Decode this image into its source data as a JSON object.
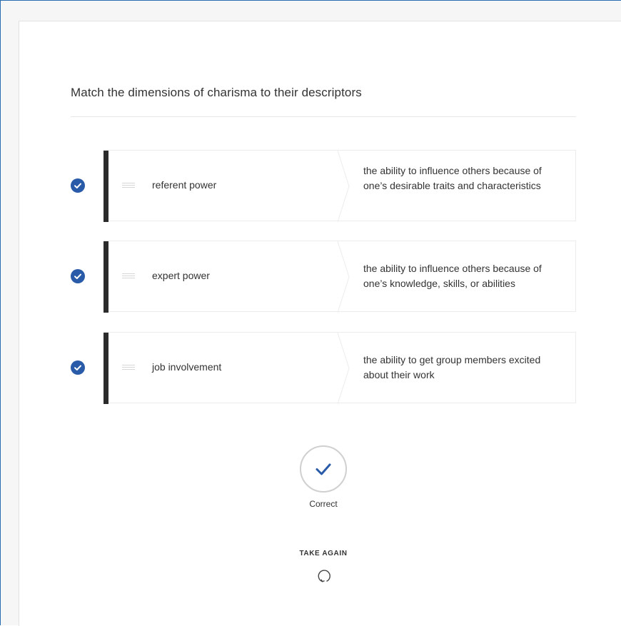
{
  "question": {
    "title": "Match the dimensions of charisma to their descriptors"
  },
  "pairs": [
    {
      "status_icon": "check-circle-icon",
      "term": "referent power",
      "descriptor": "the ability to influence others because of one’s desirable traits and characteristics"
    },
    {
      "status_icon": "check-circle-icon",
      "term": "expert power",
      "descriptor": "the ability to influence others because of one’s knowledge, skills, or abilities"
    },
    {
      "status_icon": "check-circle-icon",
      "term": "job involvement",
      "descriptor": "the ability to get group members excited about their work"
    }
  ],
  "result": {
    "icon": "check-icon",
    "label": "Correct"
  },
  "take_again": {
    "label": "TAKE AGAIN",
    "icon": "retry-icon"
  },
  "colors": {
    "accent": "#2a5ba8",
    "bar": "#2b2b2b",
    "frame_border": "#2b6cb0"
  }
}
